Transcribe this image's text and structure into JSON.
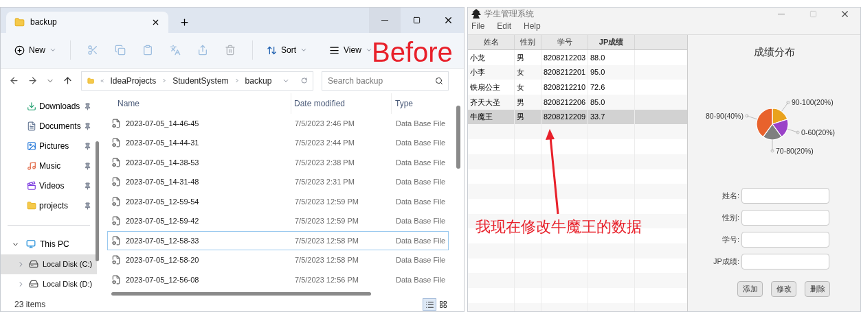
{
  "explorer": {
    "tab": {
      "title": "backup"
    },
    "toolbar": {
      "new": "New",
      "sort": "Sort",
      "view": "View"
    },
    "breadcrumb": [
      "IdeaProjects",
      "StudentSystem",
      "backup"
    ],
    "search": {
      "placeholder": "Search backup"
    },
    "sidebar": {
      "quick_access": [
        {
          "label": "Downloads",
          "kind": "download",
          "pinned": true
        },
        {
          "label": "Documents",
          "kind": "document",
          "pinned": true
        },
        {
          "label": "Pictures",
          "kind": "picture",
          "pinned": true
        },
        {
          "label": "Music",
          "kind": "music",
          "pinned": true
        },
        {
          "label": "Videos",
          "kind": "video",
          "pinned": true
        },
        {
          "label": "projects",
          "kind": "folder",
          "pinned": true
        }
      ],
      "tree": [
        {
          "label": "This PC",
          "expanded": true,
          "selected": false,
          "children": [
            {
              "label": "Local Disk (C:)",
              "expanded": false,
              "selected": true
            },
            {
              "label": "Local Disk (D:)",
              "expanded": false,
              "selected": false
            }
          ]
        }
      ]
    },
    "columns": [
      "Name",
      "Date modified",
      "Type"
    ],
    "rows": [
      {
        "name": "2023-07-05_14-46-45",
        "date": "7/5/2023 2:46 PM",
        "type": "Data Base File",
        "selected": false
      },
      {
        "name": "2023-07-05_14-44-31",
        "date": "7/5/2023 2:44 PM",
        "type": "Data Base File",
        "selected": false
      },
      {
        "name": "2023-07-05_14-38-53",
        "date": "7/5/2023 2:38 PM",
        "type": "Data Base File",
        "selected": false
      },
      {
        "name": "2023-07-05_14-31-48",
        "date": "7/5/2023 2:31 PM",
        "type": "Data Base File",
        "selected": false
      },
      {
        "name": "2023-07-05_12-59-54",
        "date": "7/5/2023 12:59 PM",
        "type": "Data Base File",
        "selected": false
      },
      {
        "name": "2023-07-05_12-59-42",
        "date": "7/5/2023 12:59 PM",
        "type": "Data Base File",
        "selected": false
      },
      {
        "name": "2023-07-05_12-58-33",
        "date": "7/5/2023 12:58 PM",
        "type": "Data Base File",
        "selected": true
      },
      {
        "name": "2023-07-05_12-58-20",
        "date": "7/5/2023 12:58 PM",
        "type": "Data Base File",
        "selected": false
      },
      {
        "name": "2023-07-05_12-56-08",
        "date": "7/5/2023 12:56 PM",
        "type": "Data Base File",
        "selected": false
      }
    ],
    "status_bar": "23 items",
    "views": [
      {
        "kind": "details",
        "selected": true
      },
      {
        "kind": "tiles",
        "selected": false
      }
    ]
  },
  "app": {
    "title": "学生管理系统",
    "menu": [
      "File",
      "Edit",
      "Help"
    ],
    "table": {
      "columns": [
        "姓名",
        "性别",
        "学号",
        "JP成绩"
      ],
      "rows": [
        {
          "cells": [
            "小龙",
            "男",
            "8208212203",
            "88.0"
          ],
          "selected": false
        },
        {
          "cells": [
            "小李",
            "女",
            "8208212201",
            "95.0"
          ],
          "selected": false
        },
        {
          "cells": [
            "铁扇公主",
            "女",
            "8208212210",
            "72.6"
          ],
          "selected": false
        },
        {
          "cells": [
            "齐天大圣",
            "男",
            "8208212206",
            "85.0"
          ],
          "selected": false
        },
        {
          "cells": [
            "牛魔王",
            "男",
            "8208212209",
            "33.7"
          ],
          "selected": true
        }
      ]
    },
    "chart": {
      "title": "成绩分布",
      "chart_data": {
        "type": "pie",
        "categories": [
          "90-100(20%)",
          "0-60(20%)",
          "70-80(20%)",
          "80-90(40%)"
        ],
        "values": [
          20,
          20,
          20,
          40
        ],
        "colors": [
          "#e9a21d",
          "#9a42c8",
          "#7f7f7f",
          "#e8622c"
        ]
      }
    },
    "form": [
      "姓名:",
      "性别:",
      "学号:",
      "JP成绩:"
    ],
    "buttons": [
      "添加",
      "修改",
      "删除"
    ]
  },
  "annotations": {
    "before": "Before",
    "note": "我现在修改牛魔王的数据"
  }
}
